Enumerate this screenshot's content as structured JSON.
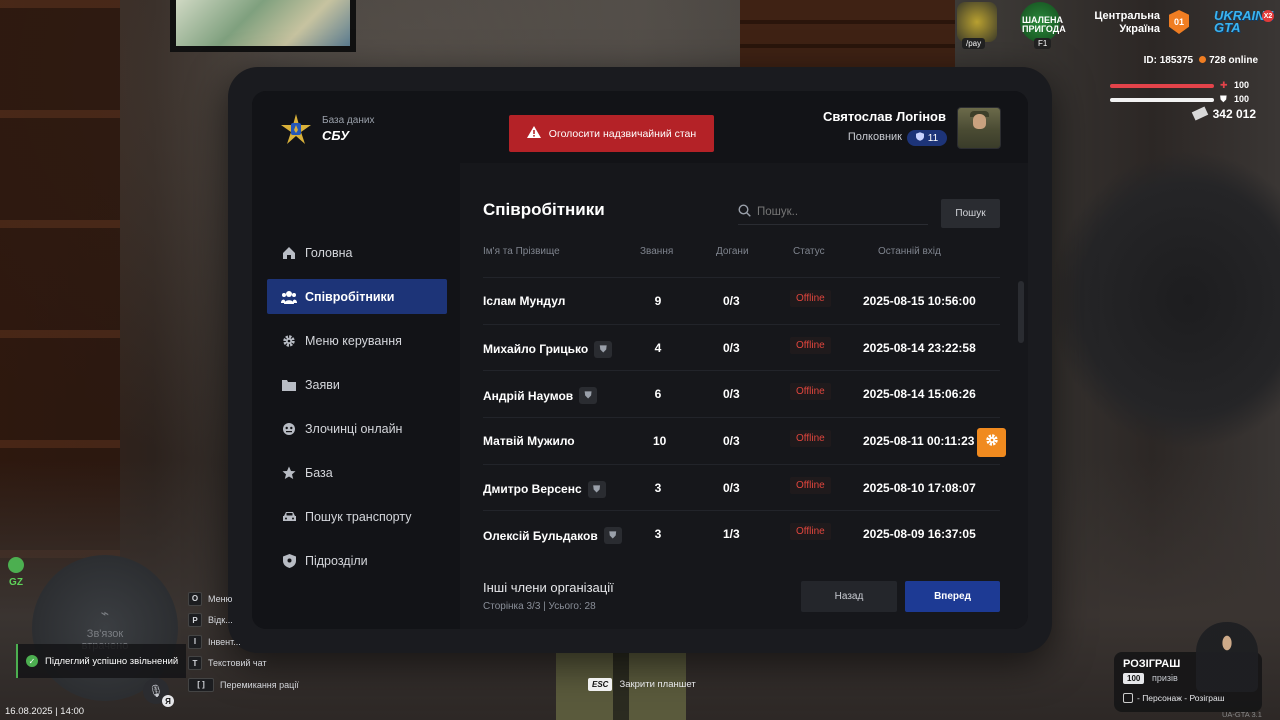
{
  "app": {
    "logo_small": "База даних",
    "logo_big": "СБУ"
  },
  "alarm_button": "Оголосити надзвичайний стан",
  "user": {
    "name": "Святослав Логінов",
    "rank": "Полковник",
    "level": "11"
  },
  "sidebar": {
    "items": [
      {
        "label": "Головна",
        "icon": "home-icon",
        "active": false
      },
      {
        "label": "Співробітники",
        "icon": "users-icon",
        "active": true
      },
      {
        "label": "Меню керування",
        "icon": "gear-icon",
        "active": false
      },
      {
        "label": "Заяви",
        "icon": "folder-icon",
        "active": false
      },
      {
        "label": "Злочинці онлайн",
        "icon": "mask-icon",
        "active": false
      },
      {
        "label": "База",
        "icon": "star-icon",
        "active": false
      },
      {
        "label": "Пошук транспорту",
        "icon": "car-icon",
        "active": false
      },
      {
        "label": "Підрозділи",
        "icon": "shield-icon",
        "active": false
      }
    ]
  },
  "main": {
    "title": "Співробітники",
    "search_placeholder": "Пошук..",
    "search_button": "Пошук",
    "columns": [
      "Ім'я та Прізвище",
      "Звання",
      "Догани",
      "Статус",
      "Останній вхід"
    ],
    "rows": [
      {
        "name": "Іслам Мундул",
        "badge": false,
        "rank": "9",
        "warns": "0/3",
        "status": "Offline",
        "last_login": "2025-08-15 10:56:00",
        "action": false
      },
      {
        "name": "Михайло Грицько",
        "badge": true,
        "rank": "4",
        "warns": "0/3",
        "status": "Offline",
        "last_login": "2025-08-14 23:22:58",
        "action": false
      },
      {
        "name": "Андрій Наумов",
        "badge": true,
        "rank": "6",
        "warns": "0/3",
        "status": "Offline",
        "last_login": "2025-08-14 15:06:26",
        "action": false
      },
      {
        "name": "Матвій Мужило",
        "badge": false,
        "rank": "10",
        "warns": "0/3",
        "status": "Offline",
        "last_login": "2025-08-11 00:11:23",
        "action": true
      },
      {
        "name": "Дмитро Версенс",
        "badge": true,
        "rank": "3",
        "warns": "0/3",
        "status": "Offline",
        "last_login": "2025-08-10 17:08:07",
        "action": false
      },
      {
        "name": "Олексій Бульдаков",
        "badge": true,
        "rank": "3",
        "warns": "1/3",
        "status": "Offline",
        "last_login": "2025-08-09 16:37:05",
        "action": false
      }
    ],
    "footer_title": "Інші члени організації",
    "footer_sub": "Сторінка 3/3 | Усього: 28",
    "back_button": "Назад",
    "next_button": "Вперед"
  },
  "hud": {
    "pay_label": "/pay",
    "adventure_label": "ШАЛЕНА ПРИГОДА",
    "adventure_key": "F1",
    "server_line1": "Центральна",
    "server_line2": "Україна",
    "server_number": "01",
    "brand": "UKRAINE GTA",
    "brand_multiplier": "X2",
    "player_id": "ID: 185375",
    "online": "728 online",
    "health": "100",
    "armor": "100",
    "money": "342 012",
    "zone": "GZ",
    "no_signal_line1": "Зв'язок",
    "no_signal_line2": "втрачено",
    "notification": "Підлеглий успішно звільнений",
    "datetime": "16.08.2025 | 14:00",
    "keybinds": [
      {
        "key": "O",
        "label": "Меню"
      },
      {
        "key": "P",
        "label": "Відк..."
      },
      {
        "key": "I",
        "label": "Інвент..."
      },
      {
        "key": "T",
        "label": "Текстовий чат"
      },
      {
        "key": "[ ]",
        "label": "Перемикання рації"
      }
    ],
    "mic_key": "Я",
    "esc_key": "ESC",
    "esc_label": "Закрити планшет",
    "giveaway_title": "РОЗІГРАШ",
    "giveaway_count": "100",
    "giveaway_prizes": "призів",
    "giveaway_sub": "- Персонаж - Розіграш",
    "version": "UA-GTA 3.1"
  }
}
